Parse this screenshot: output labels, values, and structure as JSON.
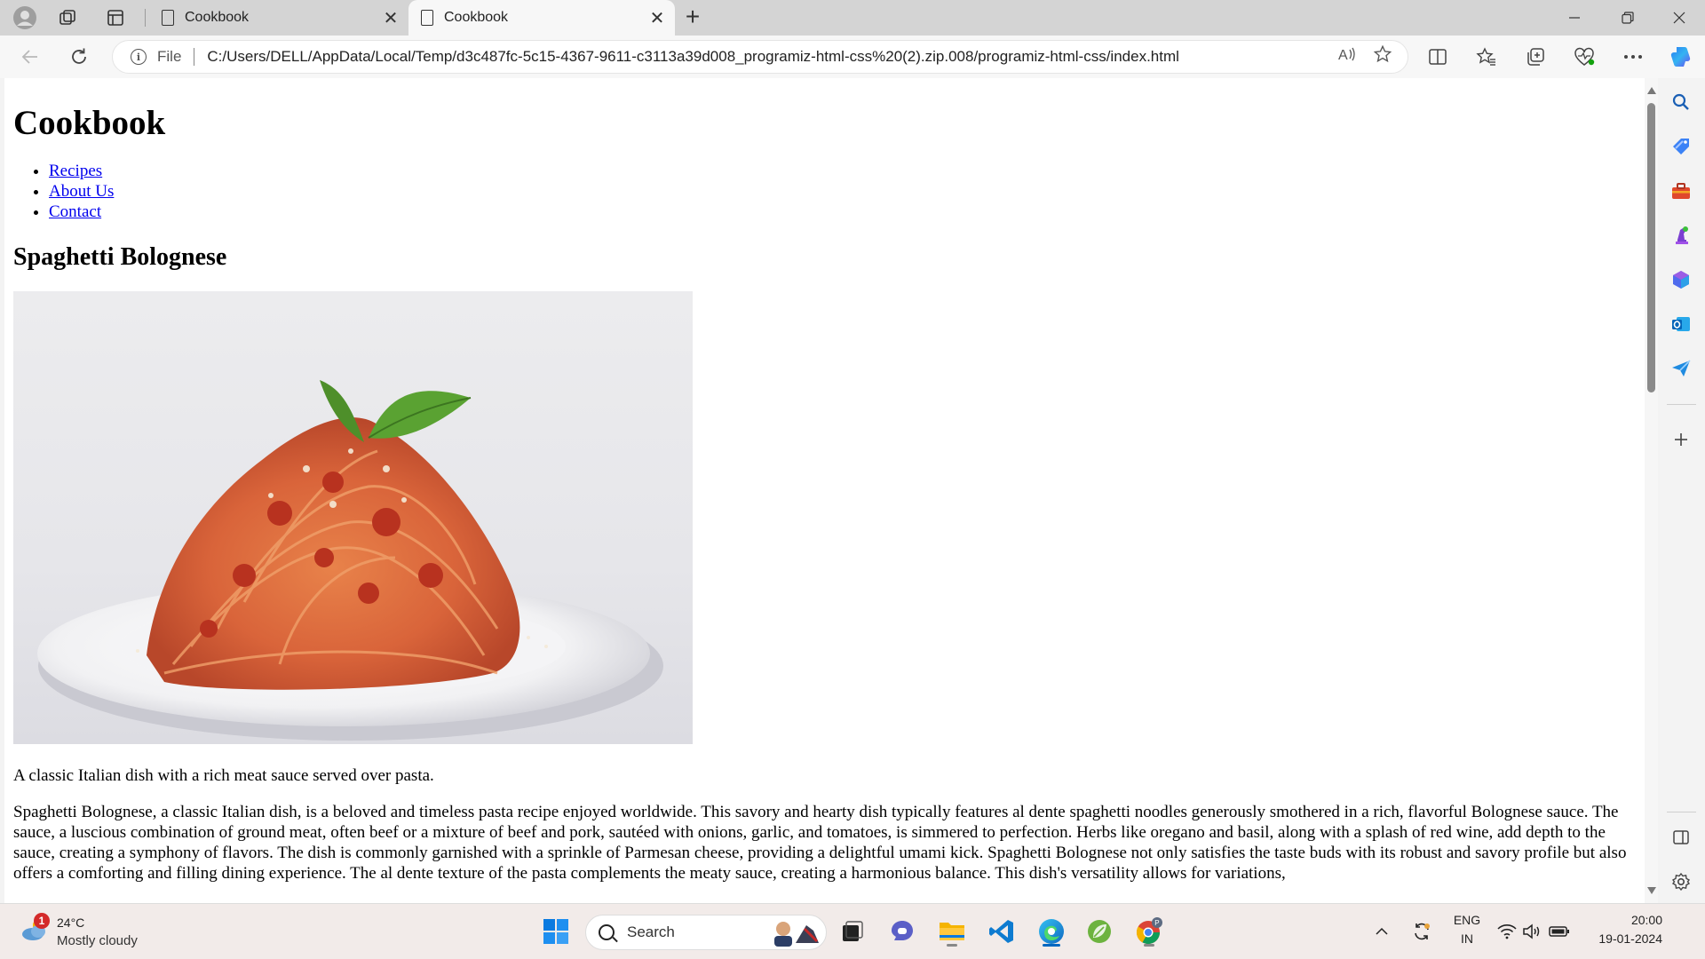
{
  "browser": {
    "tabs": [
      {
        "title": "Cookbook",
        "active": false
      },
      {
        "title": "Cookbook",
        "active": true
      }
    ],
    "address": {
      "scheme_label": "File",
      "url": "C:/Users/DELL/AppData/Local/Temp/d3c487fc-5c15-4367-9611-c3113a39d008_programiz-html-css%20(2).zip.008/programiz-html-css/index.html"
    }
  },
  "page": {
    "title": "Cookbook",
    "nav": [
      "Recipes",
      "About Us",
      "Contact"
    ],
    "recipe": {
      "name": "Spaghetti Bolognese",
      "summary": "A classic Italian dish with a rich meat sauce served over pasta.",
      "description": "Spaghetti Bolognese, a classic Italian dish, is a beloved and timeless pasta recipe enjoyed worldwide. This savory and hearty dish typically features al dente spaghetti noodles generously smothered in a rich, flavorful Bolognese sauce. The sauce, a luscious combination of ground meat, often beef or a mixture of beef and pork, sautéed with onions, garlic, and tomatoes, is simmered to perfection. Herbs like oregano and basil, along with a splash of red wine, add depth to the sauce, creating a symphony of flavors. The dish is commonly garnished with a sprinkle of Parmesan cheese, providing a delightful umami kick. Spaghetti Bolognese not only satisfies the taste buds with its robust and savory profile but also offers a comforting and filling dining experience. The al dente texture of the pasta complements the meaty sauce, creating a harmonious balance. This dish's versatility allows for variations,"
    }
  },
  "taskbar": {
    "weather": {
      "temp": "24°C",
      "condition": "Mostly cloudy",
      "badge": "1"
    },
    "search_label": "Search",
    "language": {
      "line1": "ENG",
      "line2": "IN"
    },
    "clock": {
      "time": "20:00",
      "date": "19-01-2024"
    }
  },
  "colors": {
    "link": "#0000ee",
    "tab_strip": "#d4d4d4",
    "taskbar": "#f2ebe9",
    "accent": "#0067c0"
  }
}
